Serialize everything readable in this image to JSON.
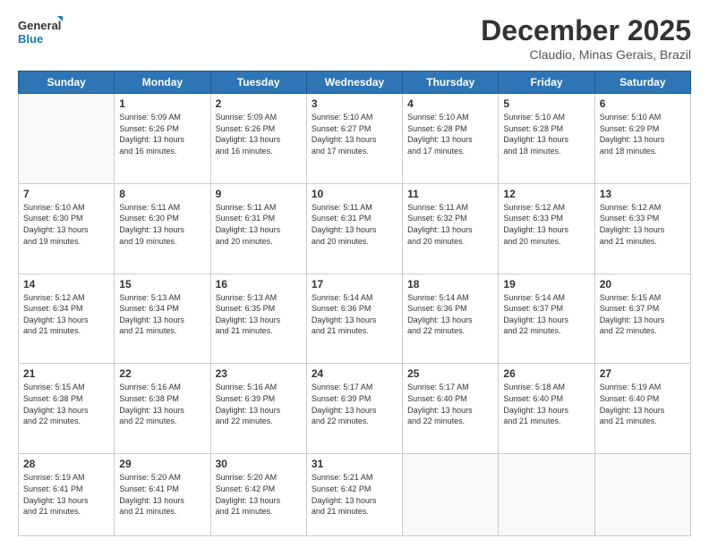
{
  "logo": {
    "line1": "General",
    "line2": "Blue"
  },
  "title": "December 2025",
  "location": "Claudio, Minas Gerais, Brazil",
  "weekdays": [
    "Sunday",
    "Monday",
    "Tuesday",
    "Wednesday",
    "Thursday",
    "Friday",
    "Saturday"
  ],
  "weeks": [
    [
      {
        "day": "",
        "info": ""
      },
      {
        "day": "1",
        "info": "Sunrise: 5:09 AM\nSunset: 6:26 PM\nDaylight: 13 hours\nand 16 minutes."
      },
      {
        "day": "2",
        "info": "Sunrise: 5:09 AM\nSunset: 6:26 PM\nDaylight: 13 hours\nand 16 minutes."
      },
      {
        "day": "3",
        "info": "Sunrise: 5:10 AM\nSunset: 6:27 PM\nDaylight: 13 hours\nand 17 minutes."
      },
      {
        "day": "4",
        "info": "Sunrise: 5:10 AM\nSunset: 6:28 PM\nDaylight: 13 hours\nand 17 minutes."
      },
      {
        "day": "5",
        "info": "Sunrise: 5:10 AM\nSunset: 6:28 PM\nDaylight: 13 hours\nand 18 minutes."
      },
      {
        "day": "6",
        "info": "Sunrise: 5:10 AM\nSunset: 6:29 PM\nDaylight: 13 hours\nand 18 minutes."
      }
    ],
    [
      {
        "day": "7",
        "info": "Sunrise: 5:10 AM\nSunset: 6:30 PM\nDaylight: 13 hours\nand 19 minutes."
      },
      {
        "day": "8",
        "info": "Sunrise: 5:11 AM\nSunset: 6:30 PM\nDaylight: 13 hours\nand 19 minutes."
      },
      {
        "day": "9",
        "info": "Sunrise: 5:11 AM\nSunset: 6:31 PM\nDaylight: 13 hours\nand 20 minutes."
      },
      {
        "day": "10",
        "info": "Sunrise: 5:11 AM\nSunset: 6:31 PM\nDaylight: 13 hours\nand 20 minutes."
      },
      {
        "day": "11",
        "info": "Sunrise: 5:11 AM\nSunset: 6:32 PM\nDaylight: 13 hours\nand 20 minutes."
      },
      {
        "day": "12",
        "info": "Sunrise: 5:12 AM\nSunset: 6:33 PM\nDaylight: 13 hours\nand 20 minutes."
      },
      {
        "day": "13",
        "info": "Sunrise: 5:12 AM\nSunset: 6:33 PM\nDaylight: 13 hours\nand 21 minutes."
      }
    ],
    [
      {
        "day": "14",
        "info": "Sunrise: 5:12 AM\nSunset: 6:34 PM\nDaylight: 13 hours\nand 21 minutes."
      },
      {
        "day": "15",
        "info": "Sunrise: 5:13 AM\nSunset: 6:34 PM\nDaylight: 13 hours\nand 21 minutes."
      },
      {
        "day": "16",
        "info": "Sunrise: 5:13 AM\nSunset: 6:35 PM\nDaylight: 13 hours\nand 21 minutes."
      },
      {
        "day": "17",
        "info": "Sunrise: 5:14 AM\nSunset: 6:36 PM\nDaylight: 13 hours\nand 21 minutes."
      },
      {
        "day": "18",
        "info": "Sunrise: 5:14 AM\nSunset: 6:36 PM\nDaylight: 13 hours\nand 22 minutes."
      },
      {
        "day": "19",
        "info": "Sunrise: 5:14 AM\nSunset: 6:37 PM\nDaylight: 13 hours\nand 22 minutes."
      },
      {
        "day": "20",
        "info": "Sunrise: 5:15 AM\nSunset: 6:37 PM\nDaylight: 13 hours\nand 22 minutes."
      }
    ],
    [
      {
        "day": "21",
        "info": "Sunrise: 5:15 AM\nSunset: 6:38 PM\nDaylight: 13 hours\nand 22 minutes."
      },
      {
        "day": "22",
        "info": "Sunrise: 5:16 AM\nSunset: 6:38 PM\nDaylight: 13 hours\nand 22 minutes."
      },
      {
        "day": "23",
        "info": "Sunrise: 5:16 AM\nSunset: 6:39 PM\nDaylight: 13 hours\nand 22 minutes."
      },
      {
        "day": "24",
        "info": "Sunrise: 5:17 AM\nSunset: 6:39 PM\nDaylight: 13 hours\nand 22 minutes."
      },
      {
        "day": "25",
        "info": "Sunrise: 5:17 AM\nSunset: 6:40 PM\nDaylight: 13 hours\nand 22 minutes."
      },
      {
        "day": "26",
        "info": "Sunrise: 5:18 AM\nSunset: 6:40 PM\nDaylight: 13 hours\nand 21 minutes."
      },
      {
        "day": "27",
        "info": "Sunrise: 5:19 AM\nSunset: 6:40 PM\nDaylight: 13 hours\nand 21 minutes."
      }
    ],
    [
      {
        "day": "28",
        "info": "Sunrise: 5:19 AM\nSunset: 6:41 PM\nDaylight: 13 hours\nand 21 minutes."
      },
      {
        "day": "29",
        "info": "Sunrise: 5:20 AM\nSunset: 6:41 PM\nDaylight: 13 hours\nand 21 minutes."
      },
      {
        "day": "30",
        "info": "Sunrise: 5:20 AM\nSunset: 6:42 PM\nDaylight: 13 hours\nand 21 minutes."
      },
      {
        "day": "31",
        "info": "Sunrise: 5:21 AM\nSunset: 6:42 PM\nDaylight: 13 hours\nand 21 minutes."
      },
      {
        "day": "",
        "info": ""
      },
      {
        "day": "",
        "info": ""
      },
      {
        "day": "",
        "info": ""
      }
    ]
  ]
}
